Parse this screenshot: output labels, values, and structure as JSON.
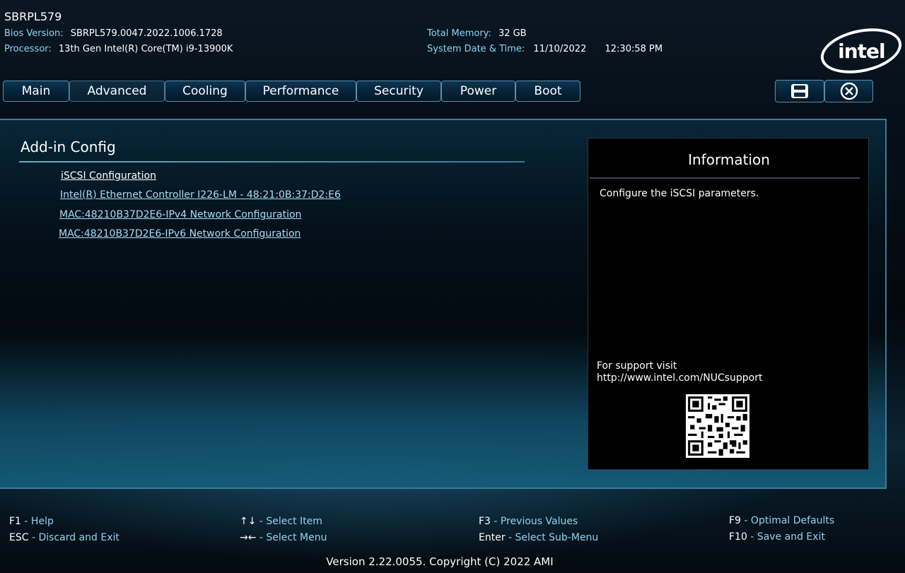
{
  "header": {
    "title": "SBRPL579",
    "bios_version_label": "Bios Version:",
    "bios_version": "SBRPL579.0047.2022.1006.1728",
    "processor_label": "Processor:",
    "processor": "13th Gen Intel(R) Core(TM) i9-13900K",
    "total_memory_label": "Total Memory:",
    "total_memory": "32 GB",
    "system_datetime_label": "System Date & Time:",
    "system_date": "11/10/2022",
    "system_time": "12:30:58 PM",
    "logo_text": "intel"
  },
  "tabs": [
    {
      "label": "Main"
    },
    {
      "label": "Advanced"
    },
    {
      "label": "Cooling"
    },
    {
      "label": "Performance"
    },
    {
      "label": "Security"
    },
    {
      "label": "Power"
    },
    {
      "label": "Boot"
    }
  ],
  "active_tab": "Advanced",
  "toolbar": {
    "save_icon": "floppy-disk-icon",
    "exit_icon": "close-circle-icon"
  },
  "main": {
    "section_title": "Add-in Config",
    "items": [
      {
        "label": "iSCSI Configuration"
      },
      {
        "label": "Intel(R) Ethernet Controller I226-LM - 48:21:0B:37:D2:E6"
      },
      {
        "label": "MAC:48210B37D2E6-IPv4 Network Configuration"
      },
      {
        "label": "MAC:48210B37D2E6-IPv6 Network Configuration"
      }
    ]
  },
  "info": {
    "title": "Information",
    "text": "Configure the iSCSI parameters.",
    "support_line1": "For support visit",
    "support_line2": "http://www.intel.com/NUCsupport",
    "qr_icon": "qr-code-icon"
  },
  "footer": {
    "keys": [
      {
        "key": "F1",
        "desc": "Help"
      },
      {
        "key": "ESC",
        "desc": "Discard and Exit"
      },
      {
        "key": "↑↓",
        "desc": "Select Item"
      },
      {
        "key": "→←",
        "desc": "Select Menu"
      },
      {
        "key": "F3",
        "desc": "Previous Values"
      },
      {
        "key": "Enter",
        "desc": "Select Sub-Menu"
      },
      {
        "key": "F9",
        "desc": "Optimal Defaults"
      },
      {
        "key": "F10",
        "desc": "Save and Exit"
      }
    ],
    "separator": " - ",
    "version": "Version 2.22.0055. Copyright (C) 2022 AMI"
  },
  "colors": {
    "accent_label": "#8fd3f0",
    "link": "#a9dcf5",
    "panel_border": "#3f7a95"
  }
}
